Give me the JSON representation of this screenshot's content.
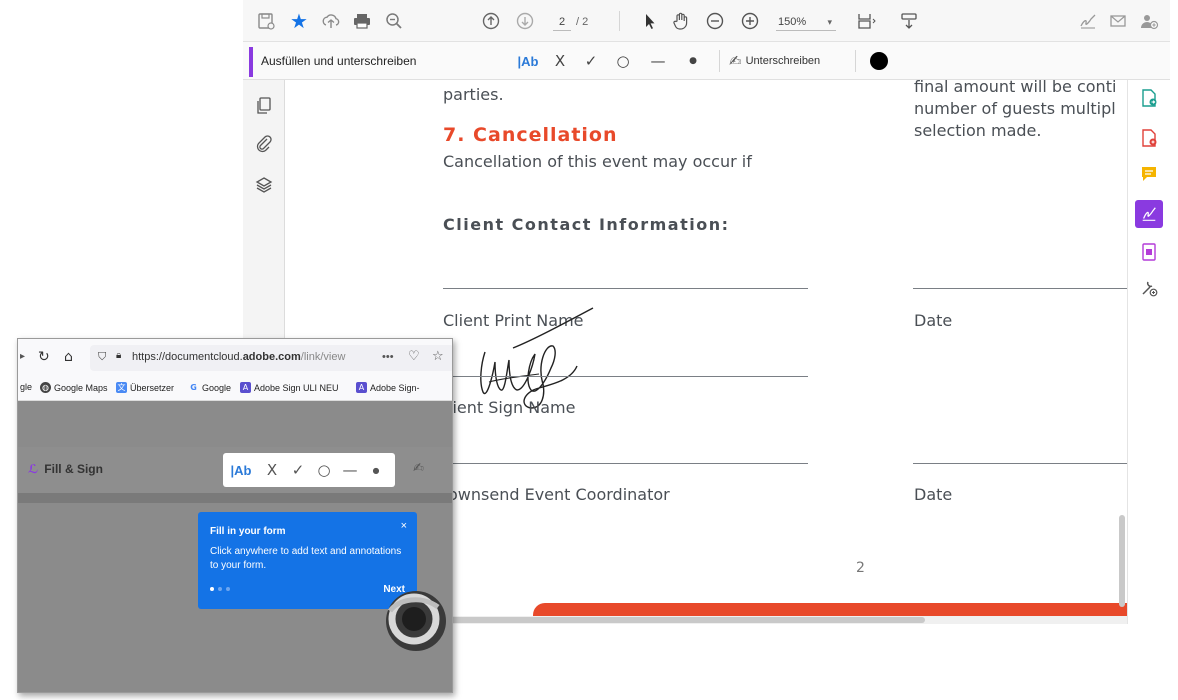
{
  "acrobat": {
    "page_current": "2",
    "page_total": "/ 2",
    "zoom": "150%",
    "fill_sign": {
      "title": "Ausfüllen und unterschreiben",
      "text_tool": "|Ab",
      "sign_label": "Unterschreiben"
    }
  },
  "document": {
    "parties": "parties.",
    "cancellation_heading": "7. Cancellation",
    "cancellation_text": "Cancellation of this event may occur if",
    "right_col_line1": "final amount will be conti",
    "right_col_line2": "number of guests multipl",
    "right_col_line3": "selection made.",
    "contact_heading": "Client Contact Information:",
    "client_print_name": "Client Print Name",
    "date_label_1": "Date",
    "client_sign_name": "lient Sign Name",
    "coordinator": "ownsend Event Coordinator",
    "date_label_2": "Date",
    "page_number": "2"
  },
  "inset": {
    "url_prefix": "https://documentcloud.",
    "url_domain": "adobe.com",
    "url_suffix": "/link/view",
    "url_menu": "•••",
    "bookmarks": [
      {
        "label": "gle"
      },
      {
        "label": "Google Maps"
      },
      {
        "label": "Übersetzer"
      },
      {
        "label": "Google"
      },
      {
        "label": "Adobe Sign ULI NEU"
      },
      {
        "label": "Adobe Sign-"
      }
    ],
    "fill_sign_title": "Fill & Sign",
    "text_tool": "|Ab",
    "tooltip": {
      "title": "Fill in your form",
      "body": "Click anywhere to add text and annotations to your form.",
      "close": "×",
      "next": "Next"
    }
  },
  "colors": {
    "accent_purple": "#8a3ae0",
    "heading_orange": "#e8492a",
    "tooltip_blue": "#1473e6",
    "star_blue": "#1473e6"
  }
}
